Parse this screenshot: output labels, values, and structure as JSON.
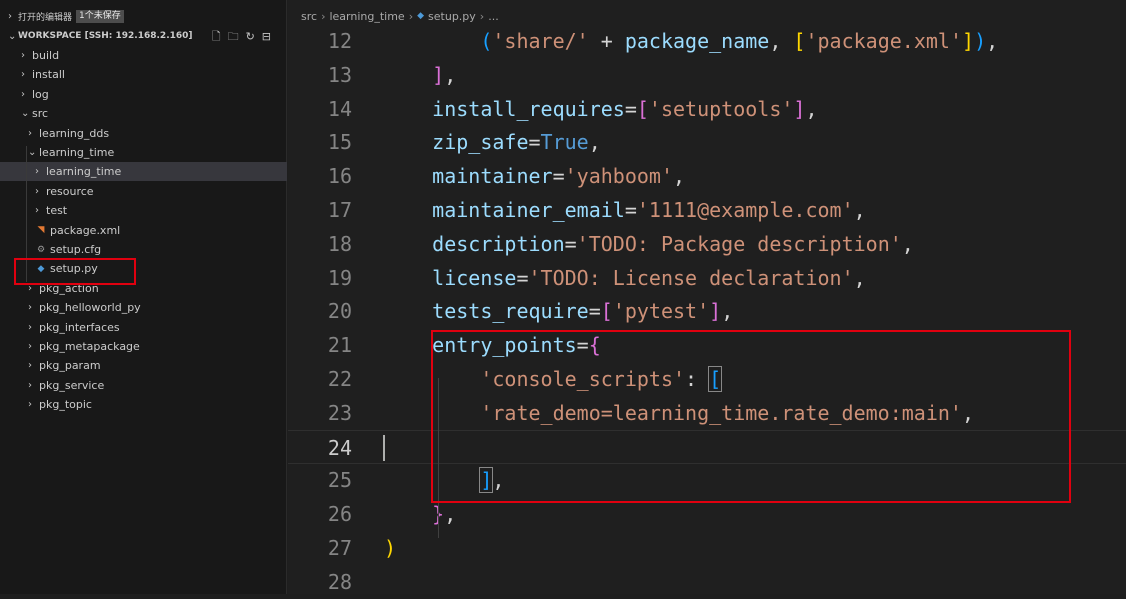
{
  "sidebar": {
    "open_editors": {
      "label": "打开的编辑器",
      "badge": "1个未保存"
    },
    "workspace": {
      "label": "WORKSPACE [SSH: 192.168.2.160]",
      "actions": [
        "new-file-icon",
        "new-folder-icon",
        "refresh-icon",
        "collapse-all-icon"
      ]
    },
    "tree": [
      {
        "label": "build",
        "kind": "folder",
        "state": "collapsed"
      },
      {
        "label": "install",
        "kind": "folder",
        "state": "collapsed"
      },
      {
        "label": "log",
        "kind": "folder",
        "state": "collapsed"
      },
      {
        "label": "src",
        "kind": "folder",
        "state": "expanded"
      },
      {
        "label": "learning_dds",
        "kind": "folder",
        "state": "collapsed"
      },
      {
        "label": "learning_time",
        "kind": "folder",
        "state": "expanded"
      },
      {
        "label": "learning_time",
        "kind": "folder",
        "state": "collapsed",
        "selected": true
      },
      {
        "label": "resource",
        "kind": "folder",
        "state": "collapsed"
      },
      {
        "label": "test",
        "kind": "folder",
        "state": "collapsed"
      },
      {
        "label": "package.xml",
        "kind": "xml-file"
      },
      {
        "label": "setup.cfg",
        "kind": "cfg-file"
      },
      {
        "label": "setup.py",
        "kind": "py-file",
        "highlighted": true
      },
      {
        "label": "pkg_action",
        "kind": "folder",
        "state": "collapsed"
      },
      {
        "label": "pkg_helloworld_py",
        "kind": "folder",
        "state": "collapsed"
      },
      {
        "label": "pkg_interfaces",
        "kind": "folder",
        "state": "collapsed"
      },
      {
        "label": "pkg_metapackage",
        "kind": "folder",
        "state": "collapsed"
      },
      {
        "label": "pkg_param",
        "kind": "folder",
        "state": "collapsed"
      },
      {
        "label": "pkg_service",
        "kind": "folder",
        "state": "collapsed"
      },
      {
        "label": "pkg_topic",
        "kind": "folder",
        "state": "collapsed"
      }
    ]
  },
  "breadcrumb": {
    "parts": [
      "src",
      "learning_time",
      "setup.py",
      "..."
    ]
  },
  "editor": {
    "current_line": "24",
    "lines": [
      {
        "n": "12",
        "tokens": [
          [
            "",
            "        "
          ],
          [
            "b3",
            "("
          ],
          [
            "str",
            "'share/'"
          ],
          [
            "op",
            " + "
          ],
          [
            "word",
            "package_name"
          ],
          [
            "op",
            ", "
          ],
          [
            "b1",
            "["
          ],
          [
            "str",
            "'package.xml'"
          ],
          [
            "b1",
            "]"
          ],
          [
            "b3",
            ")"
          ],
          [
            "op",
            ","
          ]
        ]
      },
      {
        "n": "13",
        "tokens": [
          [
            "",
            "    "
          ],
          [
            "b2",
            "]"
          ],
          [
            "op",
            ","
          ]
        ]
      },
      {
        "n": "14",
        "tokens": [
          [
            "",
            "    "
          ],
          [
            "word",
            "install_requires"
          ],
          [
            "op",
            "="
          ],
          [
            "b2",
            "["
          ],
          [
            "str",
            "'setuptools'"
          ],
          [
            "b2",
            "]"
          ],
          [
            "op",
            ","
          ]
        ]
      },
      {
        "n": "15",
        "tokens": [
          [
            "",
            "    "
          ],
          [
            "word",
            "zip_safe"
          ],
          [
            "op",
            "="
          ],
          [
            "kw",
            "True"
          ],
          [
            "op",
            ","
          ]
        ]
      },
      {
        "n": "16",
        "tokens": [
          [
            "",
            "    "
          ],
          [
            "word",
            "maintainer"
          ],
          [
            "op",
            "="
          ],
          [
            "str",
            "'yahboom'"
          ],
          [
            "op",
            ","
          ]
        ]
      },
      {
        "n": "17",
        "tokens": [
          [
            "",
            "    "
          ],
          [
            "word",
            "maintainer_email"
          ],
          [
            "op",
            "="
          ],
          [
            "str",
            "'1111@example.com'"
          ],
          [
            "op",
            ","
          ]
        ]
      },
      {
        "n": "18",
        "tokens": [
          [
            "",
            "    "
          ],
          [
            "word",
            "description"
          ],
          [
            "op",
            "="
          ],
          [
            "str",
            "'TODO: Package description'"
          ],
          [
            "op",
            ","
          ]
        ]
      },
      {
        "n": "19",
        "tokens": [
          [
            "",
            "    "
          ],
          [
            "word",
            "license"
          ],
          [
            "op",
            "="
          ],
          [
            "str",
            "'TODO: License declaration'"
          ],
          [
            "op",
            ","
          ]
        ]
      },
      {
        "n": "20",
        "tokens": [
          [
            "",
            "    "
          ],
          [
            "word",
            "tests_require"
          ],
          [
            "op",
            "="
          ],
          [
            "b2",
            "["
          ],
          [
            "str",
            "'pytest'"
          ],
          [
            "b2",
            "]"
          ],
          [
            "op",
            ","
          ]
        ]
      },
      {
        "n": "21",
        "tokens": [
          [
            "",
            "    "
          ],
          [
            "word",
            "entry_points"
          ],
          [
            "op",
            "="
          ],
          [
            "b2",
            "{"
          ]
        ]
      },
      {
        "n": "22",
        "tokens": [
          [
            "",
            "        "
          ],
          [
            "str",
            "'console_scripts'"
          ],
          [
            "op",
            ": "
          ],
          [
            "b3box",
            "["
          ]
        ]
      },
      {
        "n": "23",
        "tokens": [
          [
            "",
            "        "
          ],
          [
            "str",
            "'rate_demo=learning_time.rate_demo:main'"
          ],
          [
            "op",
            ","
          ]
        ]
      },
      {
        "n": "24",
        "tokens": []
      },
      {
        "n": "25",
        "tokens": [
          [
            "",
            "        "
          ],
          [
            "b3box",
            "]"
          ],
          [
            "op",
            ","
          ]
        ]
      },
      {
        "n": "26",
        "tokens": [
          [
            "",
            "    "
          ],
          [
            "b2",
            "}"
          ],
          [
            "op",
            ","
          ]
        ]
      },
      {
        "n": "27",
        "tokens": [
          [
            "b1",
            ")"
          ]
        ]
      },
      {
        "n": "28",
        "tokens": []
      }
    ]
  },
  "colors": {
    "annotation_red": "#e0000f",
    "editor_bg": "#1f1f1f",
    "sidebar_bg": "#181818"
  }
}
